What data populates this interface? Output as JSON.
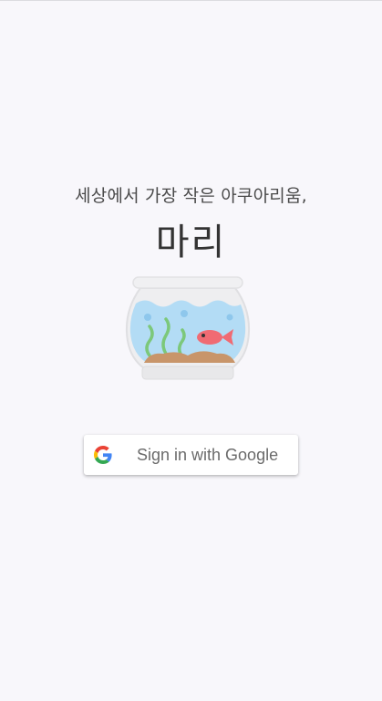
{
  "intro": {
    "tagline": "세상에서 가장 작은 아쿠아리움,",
    "app_name": "마리"
  },
  "illustration": {
    "icon": "fishbowl-icon",
    "fish_icon": "fish-icon",
    "colors": {
      "water": "#b3dcf5",
      "fish": "#f06b73",
      "seaweed": "#7cc87a",
      "sand": "#c8956a",
      "glass": "#e6e6e6"
    }
  },
  "auth": {
    "google_button_label": "Sign in with Google",
    "google_icon": "google-icon",
    "colors": {
      "blue": "#4285F4",
      "red": "#EA4335",
      "yellow": "#FBBC05",
      "green": "#34A853"
    }
  },
  "theme": {
    "background": "#f8f7fb"
  }
}
